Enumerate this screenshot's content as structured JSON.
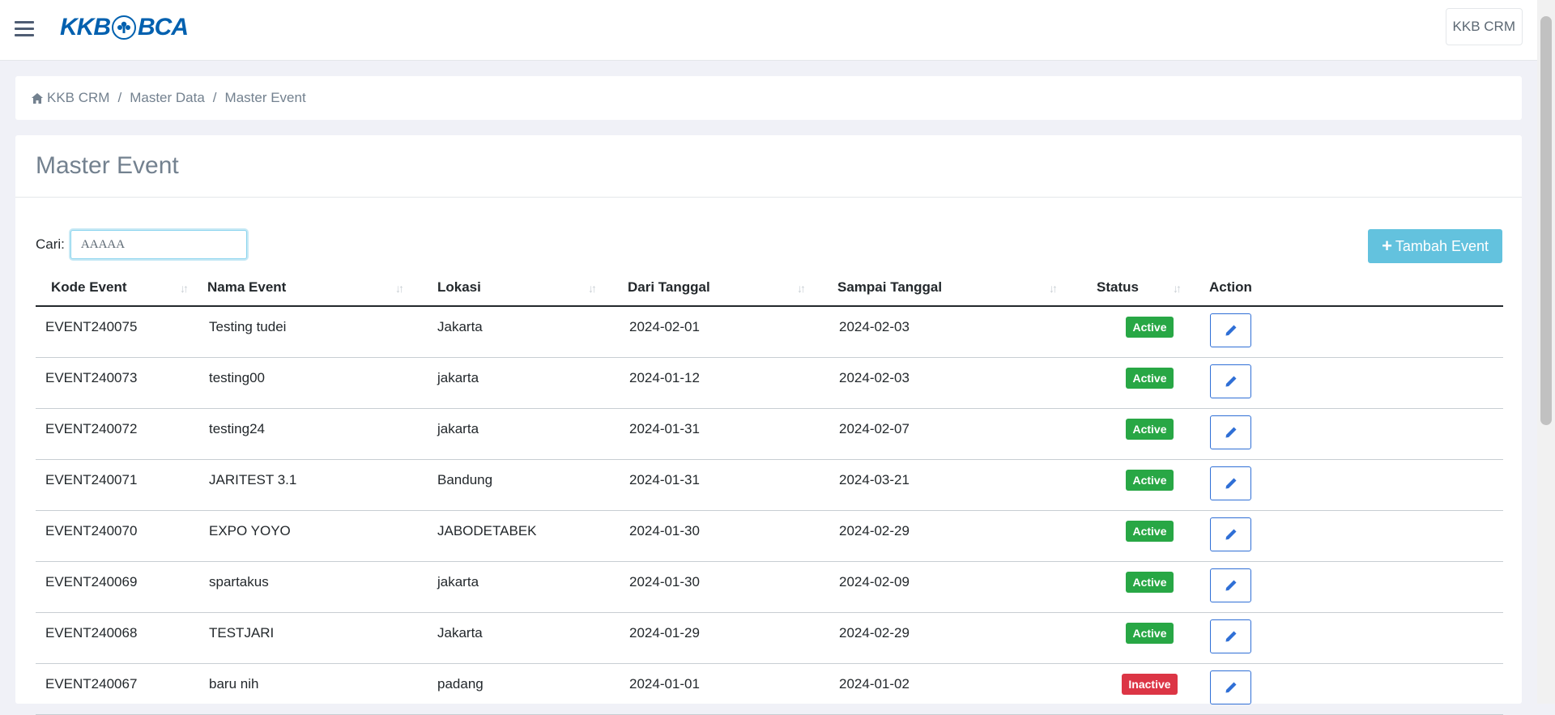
{
  "header": {
    "logo_text_left": "KKB",
    "logo_text_right": "BCA",
    "user_label": "KKB CRM"
  },
  "breadcrumb": {
    "items": [
      {
        "label": "KKB CRM",
        "icon": "home-icon"
      },
      {
        "label": "Master Data"
      },
      {
        "label": "Master Event"
      }
    ],
    "separator": "/"
  },
  "page": {
    "title": "Master Event"
  },
  "search": {
    "label": "Cari:",
    "value": "AAAAA"
  },
  "actions": {
    "add_label": "Tambah Event",
    "add_icon": "plus-icon"
  },
  "table": {
    "headers": [
      "Kode Event",
      "Nama Event",
      "Lokasi",
      "Dari Tanggal",
      "Sampai Tanggal",
      "Status",
      "Action"
    ],
    "rows": [
      {
        "kode": "EVENT240075",
        "nama": "Testing tudei",
        "lokasi": "Jakarta",
        "dari": "2024-02-01",
        "sampai": "2024-02-03",
        "status": "Active"
      },
      {
        "kode": "EVENT240073",
        "nama": "testing00",
        "lokasi": "jakarta",
        "dari": "2024-01-12",
        "sampai": "2024-02-03",
        "status": "Active"
      },
      {
        "kode": "EVENT240072",
        "nama": "testing24",
        "lokasi": "jakarta",
        "dari": "2024-01-31",
        "sampai": "2024-02-07",
        "status": "Active"
      },
      {
        "kode": "EVENT240071",
        "nama": "JARITEST 3.1",
        "lokasi": "Bandung",
        "dari": "2024-01-31",
        "sampai": "2024-03-21",
        "status": "Active"
      },
      {
        "kode": "EVENT240070",
        "nama": "EXPO YOYO",
        "lokasi": "JABODETABEK",
        "dari": "2024-01-30",
        "sampai": "2024-02-29",
        "status": "Active"
      },
      {
        "kode": "EVENT240069",
        "nama": "spartakus",
        "lokasi": "jakarta",
        "dari": "2024-01-30",
        "sampai": "2024-02-09",
        "status": "Active"
      },
      {
        "kode": "EVENT240068",
        "nama": "TESTJARI",
        "lokasi": "Jakarta",
        "dari": "2024-01-29",
        "sampai": "2024-02-29",
        "status": "Active"
      },
      {
        "kode": "EVENT240067",
        "nama": "baru nih",
        "lokasi": "padang",
        "dari": "2024-01-01",
        "sampai": "2024-01-02",
        "status": "Inactive"
      }
    ]
  },
  "colors": {
    "brand": "#0060af",
    "active": "#28a745",
    "inactive": "#dc3545",
    "add_button": "#63c2de",
    "edit_icon": "#2f6fd6"
  }
}
